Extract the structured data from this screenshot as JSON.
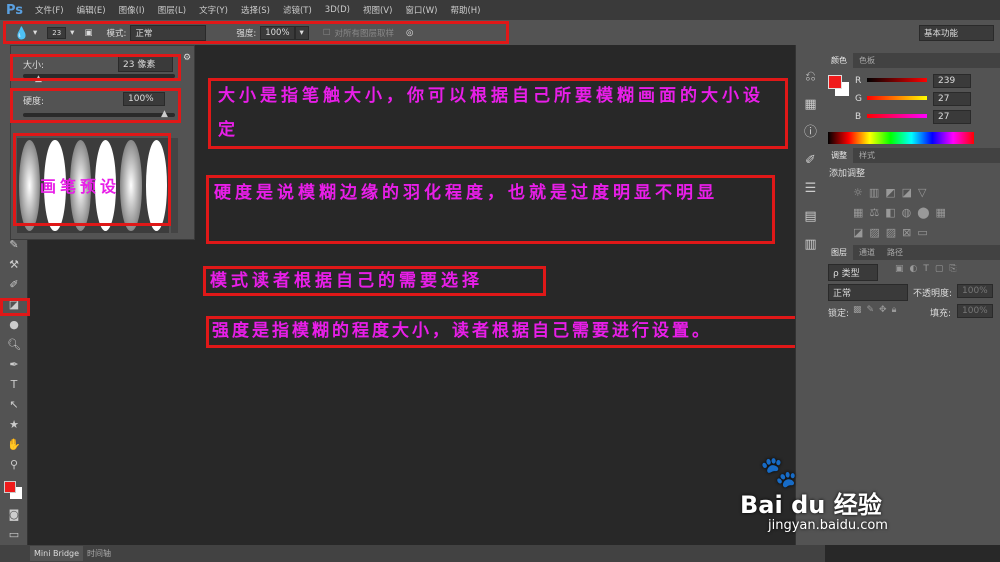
{
  "app": {
    "logo": "Ps"
  },
  "menu": [
    "文件(F)",
    "编辑(E)",
    "图像(I)",
    "图层(L)",
    "文字(Y)",
    "选择(S)",
    "滤镜(T)",
    "3D(D)",
    "视图(V)",
    "窗口(W)",
    "帮助(H)"
  ],
  "options": {
    "brush_size": "23",
    "mode_label": "模式:",
    "mode_value": "正常",
    "strength_label": "强度:",
    "strength_value": "100%",
    "sample_all": "对所有图层取样",
    "workspace": "基本功能"
  },
  "brush_panel": {
    "size_label": "大小:",
    "size_value": "23 像素",
    "hardness_label": "硬度:",
    "hardness_value": "100%",
    "size_fraction": 0.1,
    "hardness_fraction": 1.0
  },
  "color_panel": {
    "tabs": [
      "颜色",
      "色板"
    ],
    "r_label": "R",
    "g_label": "G",
    "b_label": "B",
    "r": "239",
    "g": "27",
    "b": "27",
    "fg_color": "#ef1b1b",
    "bg_color": "#ffffff"
  },
  "adjust_panel": {
    "tabs": [
      "调整",
      "样式"
    ],
    "title": "添加调整"
  },
  "layers_panel": {
    "tabs": [
      "图层",
      "通道",
      "路径"
    ],
    "filter": "ρ 类型",
    "blend": "正常",
    "opacity_label": "不透明度:",
    "opacity": "100%",
    "lock_label": "锁定:",
    "fill_label": "填充:",
    "fill": "100%"
  },
  "annotations": {
    "size": "大小是指笔触大小，你可以根据自己所要模糊画面的大小设定",
    "hardness": "硬度是说模糊边缘的羽化程度，也就是过度明显不明显",
    "mode": "模式读者根据自己的需要选择",
    "strength": "强度是指模糊的程度大小，读者根据自己需要进行设置。",
    "preset": "画笔预设"
  },
  "bottom": {
    "tabs": [
      "Mini Bridge",
      "时间轴"
    ]
  },
  "watermark": {
    "brand": "Bai du 经验",
    "url": "jingyan.baidu.com"
  },
  "colors": {
    "annotation": "#e81ee8",
    "box": "#e01818"
  }
}
